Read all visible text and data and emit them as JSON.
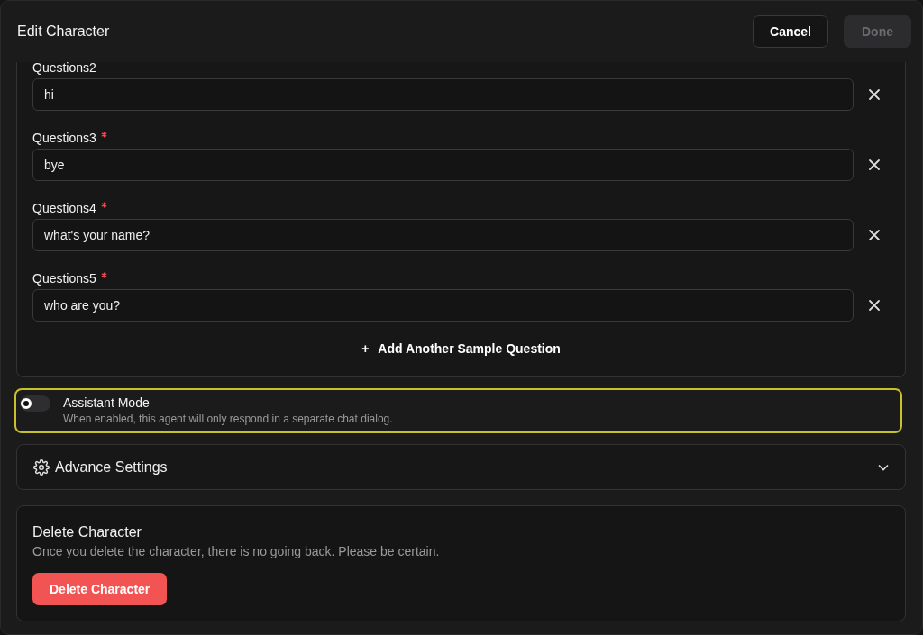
{
  "window": {
    "title": "Edit Character"
  },
  "header_buttons": [
    {
      "label": "Cancel",
      "disabled": false
    },
    {
      "label": "Done",
      "disabled": true
    }
  ],
  "questions": [
    {
      "label": "Questions2",
      "required": false,
      "value": "hi"
    },
    {
      "label": "Questions3",
      "required": true,
      "value": "bye"
    },
    {
      "label": "Questions4",
      "required": true,
      "value": "what's your name?"
    },
    {
      "label": "Questions5",
      "required": true,
      "value": "who are you?"
    }
  ],
  "add_question": {
    "label": "Add Another Sample Question",
    "icon": "+"
  },
  "assistant_mode": {
    "label": "Assistant Mode",
    "description": "When enabled, this agent will only respond in a separate chat dialog.",
    "on": false
  },
  "advance_settings": {
    "label": "Advance Settings",
    "expanded": false
  },
  "danger_zone": {
    "title": "Delete Character",
    "description": "Once you delete the character, there is no going back. Please be certain.",
    "button": "Delete Character"
  }
}
